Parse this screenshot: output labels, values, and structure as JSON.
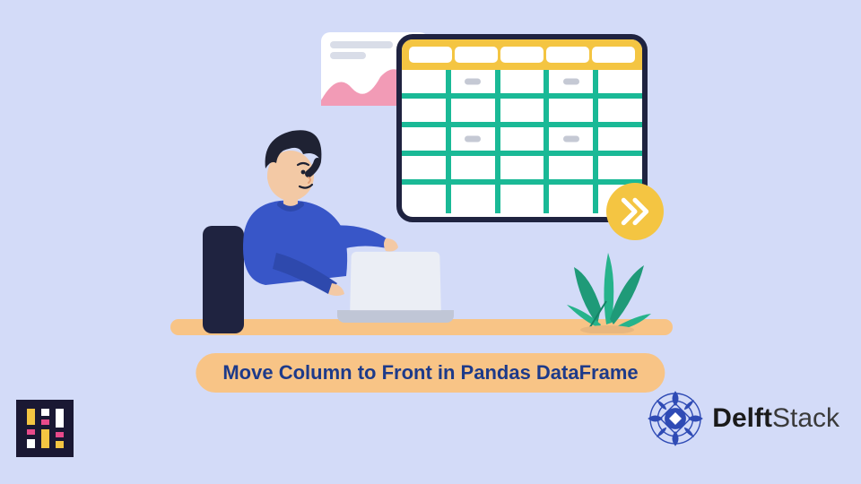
{
  "title": "Move Column to Front in Pandas DataFrame",
  "brand": {
    "name_strong": "Delft",
    "name_light": "Stack"
  },
  "icons": {
    "forward": "double-chevron-right-icon",
    "medallion": "ornate-medallion-icon",
    "mini_logo": "bars-logo-icon"
  }
}
